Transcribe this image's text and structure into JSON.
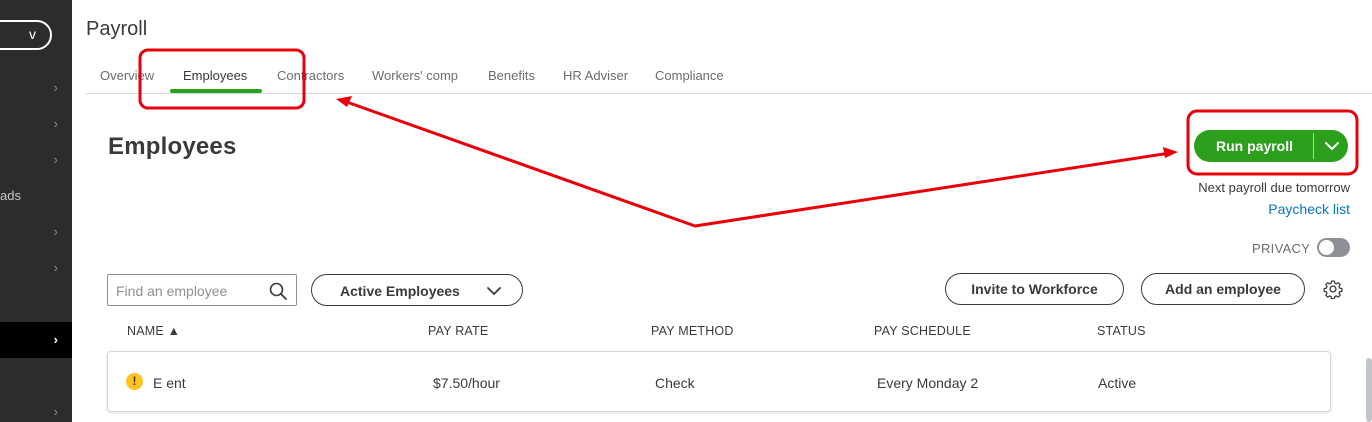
{
  "sidebar": {
    "new_button_label": "v",
    "items": [
      {
        "label": "",
        "has_chevron": true
      },
      {
        "label": "",
        "has_chevron": true
      },
      {
        "label": "",
        "has_chevron": true
      },
      {
        "label": "ads",
        "has_chevron": false
      },
      {
        "label": "",
        "has_chevron": true
      },
      {
        "label": "",
        "has_chevron": true
      },
      {
        "label": "",
        "has_chevron": true,
        "active": true
      },
      {
        "label": "",
        "has_chevron": true
      }
    ],
    "chevron_glyph": "›"
  },
  "header": {
    "page_title": "Payroll"
  },
  "tabs": [
    {
      "label": "Overview"
    },
    {
      "label": "Employees",
      "active": true
    },
    {
      "label": "Contractors"
    },
    {
      "label": "Workers' comp"
    },
    {
      "label": "Benefits"
    },
    {
      "label": "HR Adviser"
    },
    {
      "label": "Compliance"
    }
  ],
  "section": {
    "title": "Employees",
    "run_payroll_label": "Run payroll",
    "next_payroll_text": "Next payroll due tomorrow",
    "paycheck_list_link": "Paycheck list",
    "privacy_label": "PRIVACY",
    "privacy_on": false
  },
  "toolbar": {
    "search_placeholder": "Find an employee",
    "filter_label": "Active Employees",
    "invite_label": "Invite to Workforce",
    "add_label": "Add an employee"
  },
  "table": {
    "columns": [
      "NAME ▲",
      "PAY RATE",
      "PAY METHOD",
      "PAY SCHEDULE",
      "STATUS"
    ],
    "rows": [
      {
        "warning_glyph": "!",
        "name": "E          ent",
        "pay_rate": "$7.50/hour",
        "pay_method": "Check",
        "pay_schedule": "Every Monday 2",
        "status": "Active"
      }
    ]
  },
  "colors": {
    "accent_green": "#2ca01c",
    "link_blue": "#0077c5",
    "annotation_red": "#e8000b",
    "warning_yellow": "#ffc220",
    "sidebar_bg": "#2b2c2e"
  },
  "icons": {
    "search": "search-icon",
    "filter_caret": "chevron-down-icon",
    "run_caret": "chevron-down-icon",
    "settings": "gear-icon",
    "warning": "warning-icon"
  }
}
